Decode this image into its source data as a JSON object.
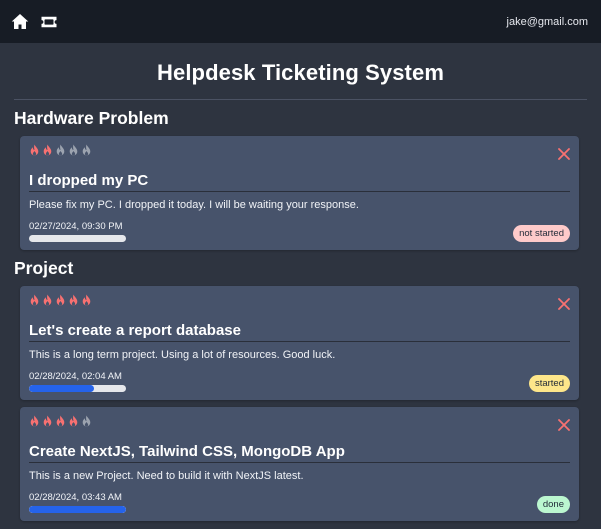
{
  "nav": {
    "home_icon": "home-icon",
    "ticket_icon": "ticket-icon",
    "user_email": "jake@gmail.com"
  },
  "page": {
    "title": "Helpdesk Ticketing System"
  },
  "colors": {
    "flame_active": "#f87171",
    "flame_inactive": "#9ca3af",
    "close": "#f87171",
    "progress": "#2563eb"
  },
  "categories": [
    {
      "name": "Hardware Problem",
      "tickets": [
        {
          "priority": 2,
          "priority_max": 5,
          "title": "I dropped my PC",
          "description": "Please fix my PC. I dropped it today. I will be waiting your response.",
          "date": "02/27/2024, 09:30 PM",
          "progress": 0,
          "status": "not started"
        }
      ]
    },
    {
      "name": "Project",
      "tickets": [
        {
          "priority": 5,
          "priority_max": 5,
          "title": "Let's create a report database",
          "description": "This is a long term project. Using a lot of resources. Good luck.",
          "date": "02/28/2024, 02:04 AM",
          "progress": 0.67,
          "status": "started"
        },
        {
          "priority": 4,
          "priority_max": 5,
          "title": "Create NextJS, Tailwind CSS, MongoDB App",
          "description": "This is a new Project. Need to build it with NextJS latest.",
          "date": "02/28/2024, 03:43 AM",
          "progress": 1.0,
          "status": "done"
        }
      ]
    }
  ]
}
